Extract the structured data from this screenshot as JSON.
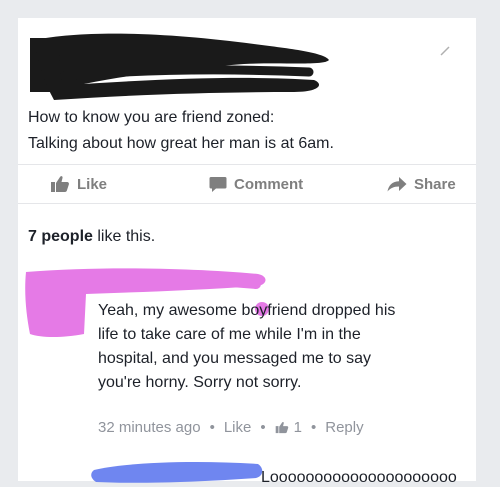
{
  "post": {
    "lines": [
      "How to know you are friend zoned:",
      "Talking about how great her man is at 6am."
    ]
  },
  "actions": {
    "like": "Like",
    "comment": "Comment",
    "share": "Share"
  },
  "likes": {
    "count_text": "7 people",
    "suffix": "like this."
  },
  "comment": {
    "lines": [
      "Yeah, my awesome boyfriend dropped his",
      "life to take care of me while I'm in the",
      "hospital, and you messaged me to say",
      "you're horny. Sorry not sorry."
    ],
    "time": "32 minutes ago",
    "like": "Like",
    "like_count": "1",
    "reply": "Reply"
  },
  "reply": {
    "text_visible": "Looooooooooooooooooooo"
  },
  "colors": {
    "background": "#e9ebee",
    "card": "#ffffff",
    "action_gray": "#7f7f7f",
    "meta_gray": "#90949c",
    "redact_black": "#1a1a1a",
    "redact_pink": "#e57ae6",
    "redact_blue": "#6f86f0"
  },
  "icons": [
    "thumbs-up-icon",
    "comment-bubble-icon",
    "share-arrow-icon"
  ]
}
